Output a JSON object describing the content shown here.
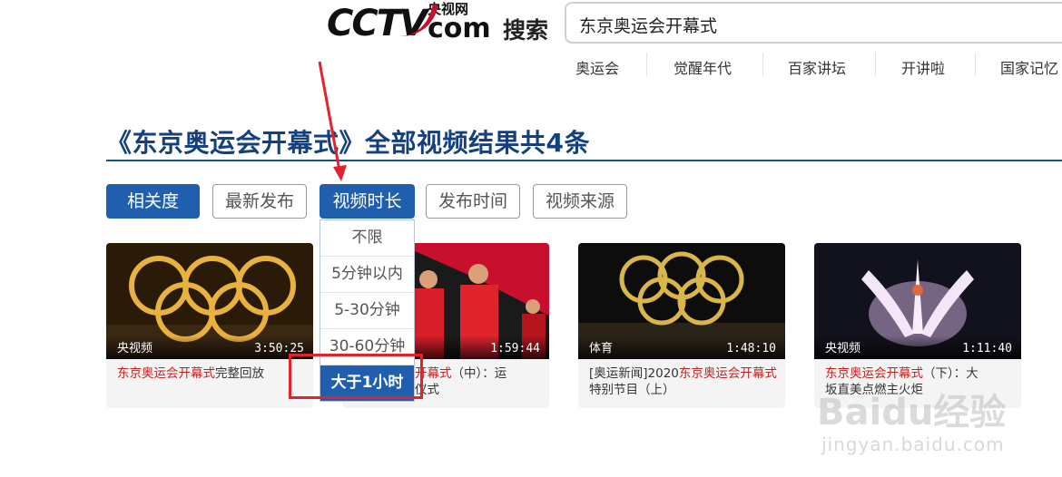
{
  "header": {
    "logo_text": "CCTV",
    "logo_cn": "央视网",
    "logo_com": "com",
    "logo_search": "搜索",
    "search_value": "东京奥运会开幕式"
  },
  "hot_links": [
    "奥运会",
    "觉醒年代",
    "百家讲坛",
    "开讲啦",
    "国家记忆"
  ],
  "result_title": "《东京奥运会开幕式》全部视频结果共4条",
  "filters": [
    "相关度",
    "最新发布",
    "视频时长",
    "发布时间",
    "视频来源"
  ],
  "duration_options": [
    "不限",
    "5分钟以内",
    "5-30分钟",
    "30-60分钟",
    "大于1小时"
  ],
  "cards": [
    {
      "source": "央视频",
      "duration": "3:50:25",
      "caption_hl": "东京奥运会开幕式",
      "caption_rest": "完整回放"
    },
    {
      "source": "",
      "duration": "1:59:44",
      "caption_hl": "开幕式",
      "caption_rest": "（中）：运",
      "caption_line2": "仪式"
    },
    {
      "source": "体育",
      "duration": "1:48:10",
      "caption_pre": "[奥运新闻]2020",
      "caption_hl": "东京奥运会开幕式",
      "caption_rest": "特别节目（上）"
    },
    {
      "source": "央视频",
      "duration": "1:11:40",
      "caption_hl": "东京奥运会开幕式",
      "caption_rest": "（下）：大",
      "caption_line2": "坂直美点燃主火炬"
    }
  ],
  "watermark": {
    "brand": "Baidu经验",
    "url": "jingyan.baidu.com"
  },
  "colors": {
    "accent": "#1f5fae",
    "highlight": "#c41f1f",
    "annotation": "#e3222b"
  }
}
